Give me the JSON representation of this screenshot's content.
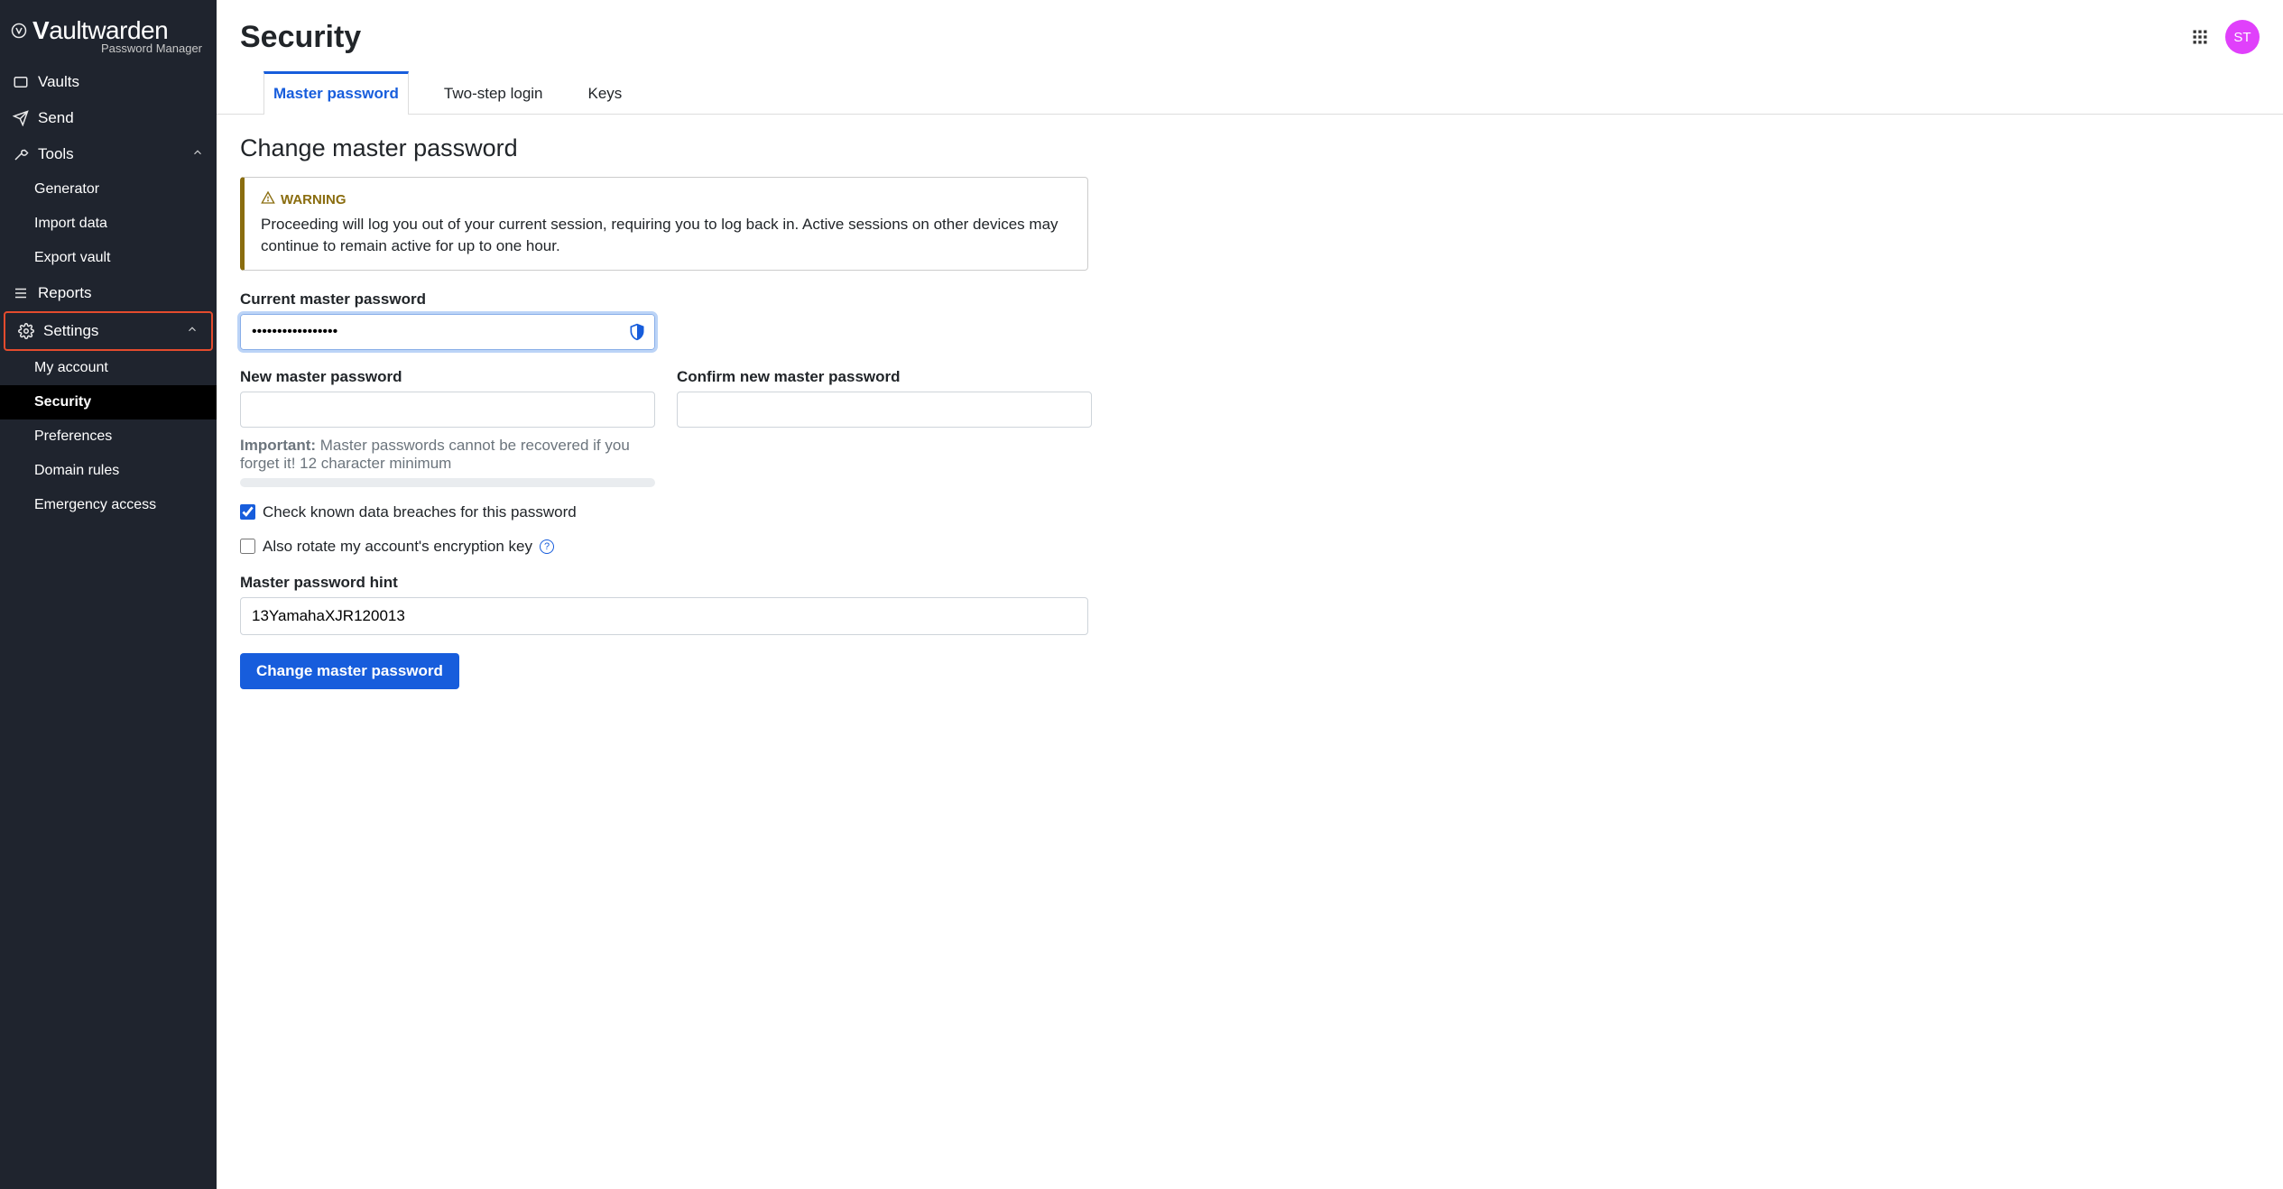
{
  "app": {
    "name_bold": "V",
    "name_rest": "aultwarden",
    "subtitle": "Password Manager"
  },
  "avatar_initials": "ST",
  "sidebar": {
    "vaults": "Vaults",
    "send": "Send",
    "tools": "Tools",
    "generator": "Generator",
    "import_data": "Import data",
    "export_vault": "Export vault",
    "reports": "Reports",
    "settings": "Settings",
    "my_account": "My account",
    "security": "Security",
    "preferences": "Preferences",
    "domain_rules": "Domain rules",
    "emergency_access": "Emergency access"
  },
  "page": {
    "title": "Security"
  },
  "tabs": {
    "master_password": "Master password",
    "two_step": "Two-step login",
    "keys": "Keys"
  },
  "section": {
    "heading": "Change master password",
    "warning_label": "WARNING",
    "warning_body": "Proceeding will log you out of your current session, requiring you to log back in. Active sessions on other devices may continue to remain active for up to one hour.",
    "current_label": "Current master password",
    "current_value": "•••••••••••••••••",
    "new_label": "New master password",
    "confirm_label": "Confirm new master password",
    "important_prefix": "Important:",
    "important_rest": " Master passwords cannot be recovered if you forget it! 12 character minimum",
    "check_breaches": "Check known data breaches for this password",
    "rotate_key": "Also rotate my account's encryption key",
    "hint_label": "Master password hint",
    "hint_value": "13YamahaXJR120013",
    "button": "Change master password"
  }
}
